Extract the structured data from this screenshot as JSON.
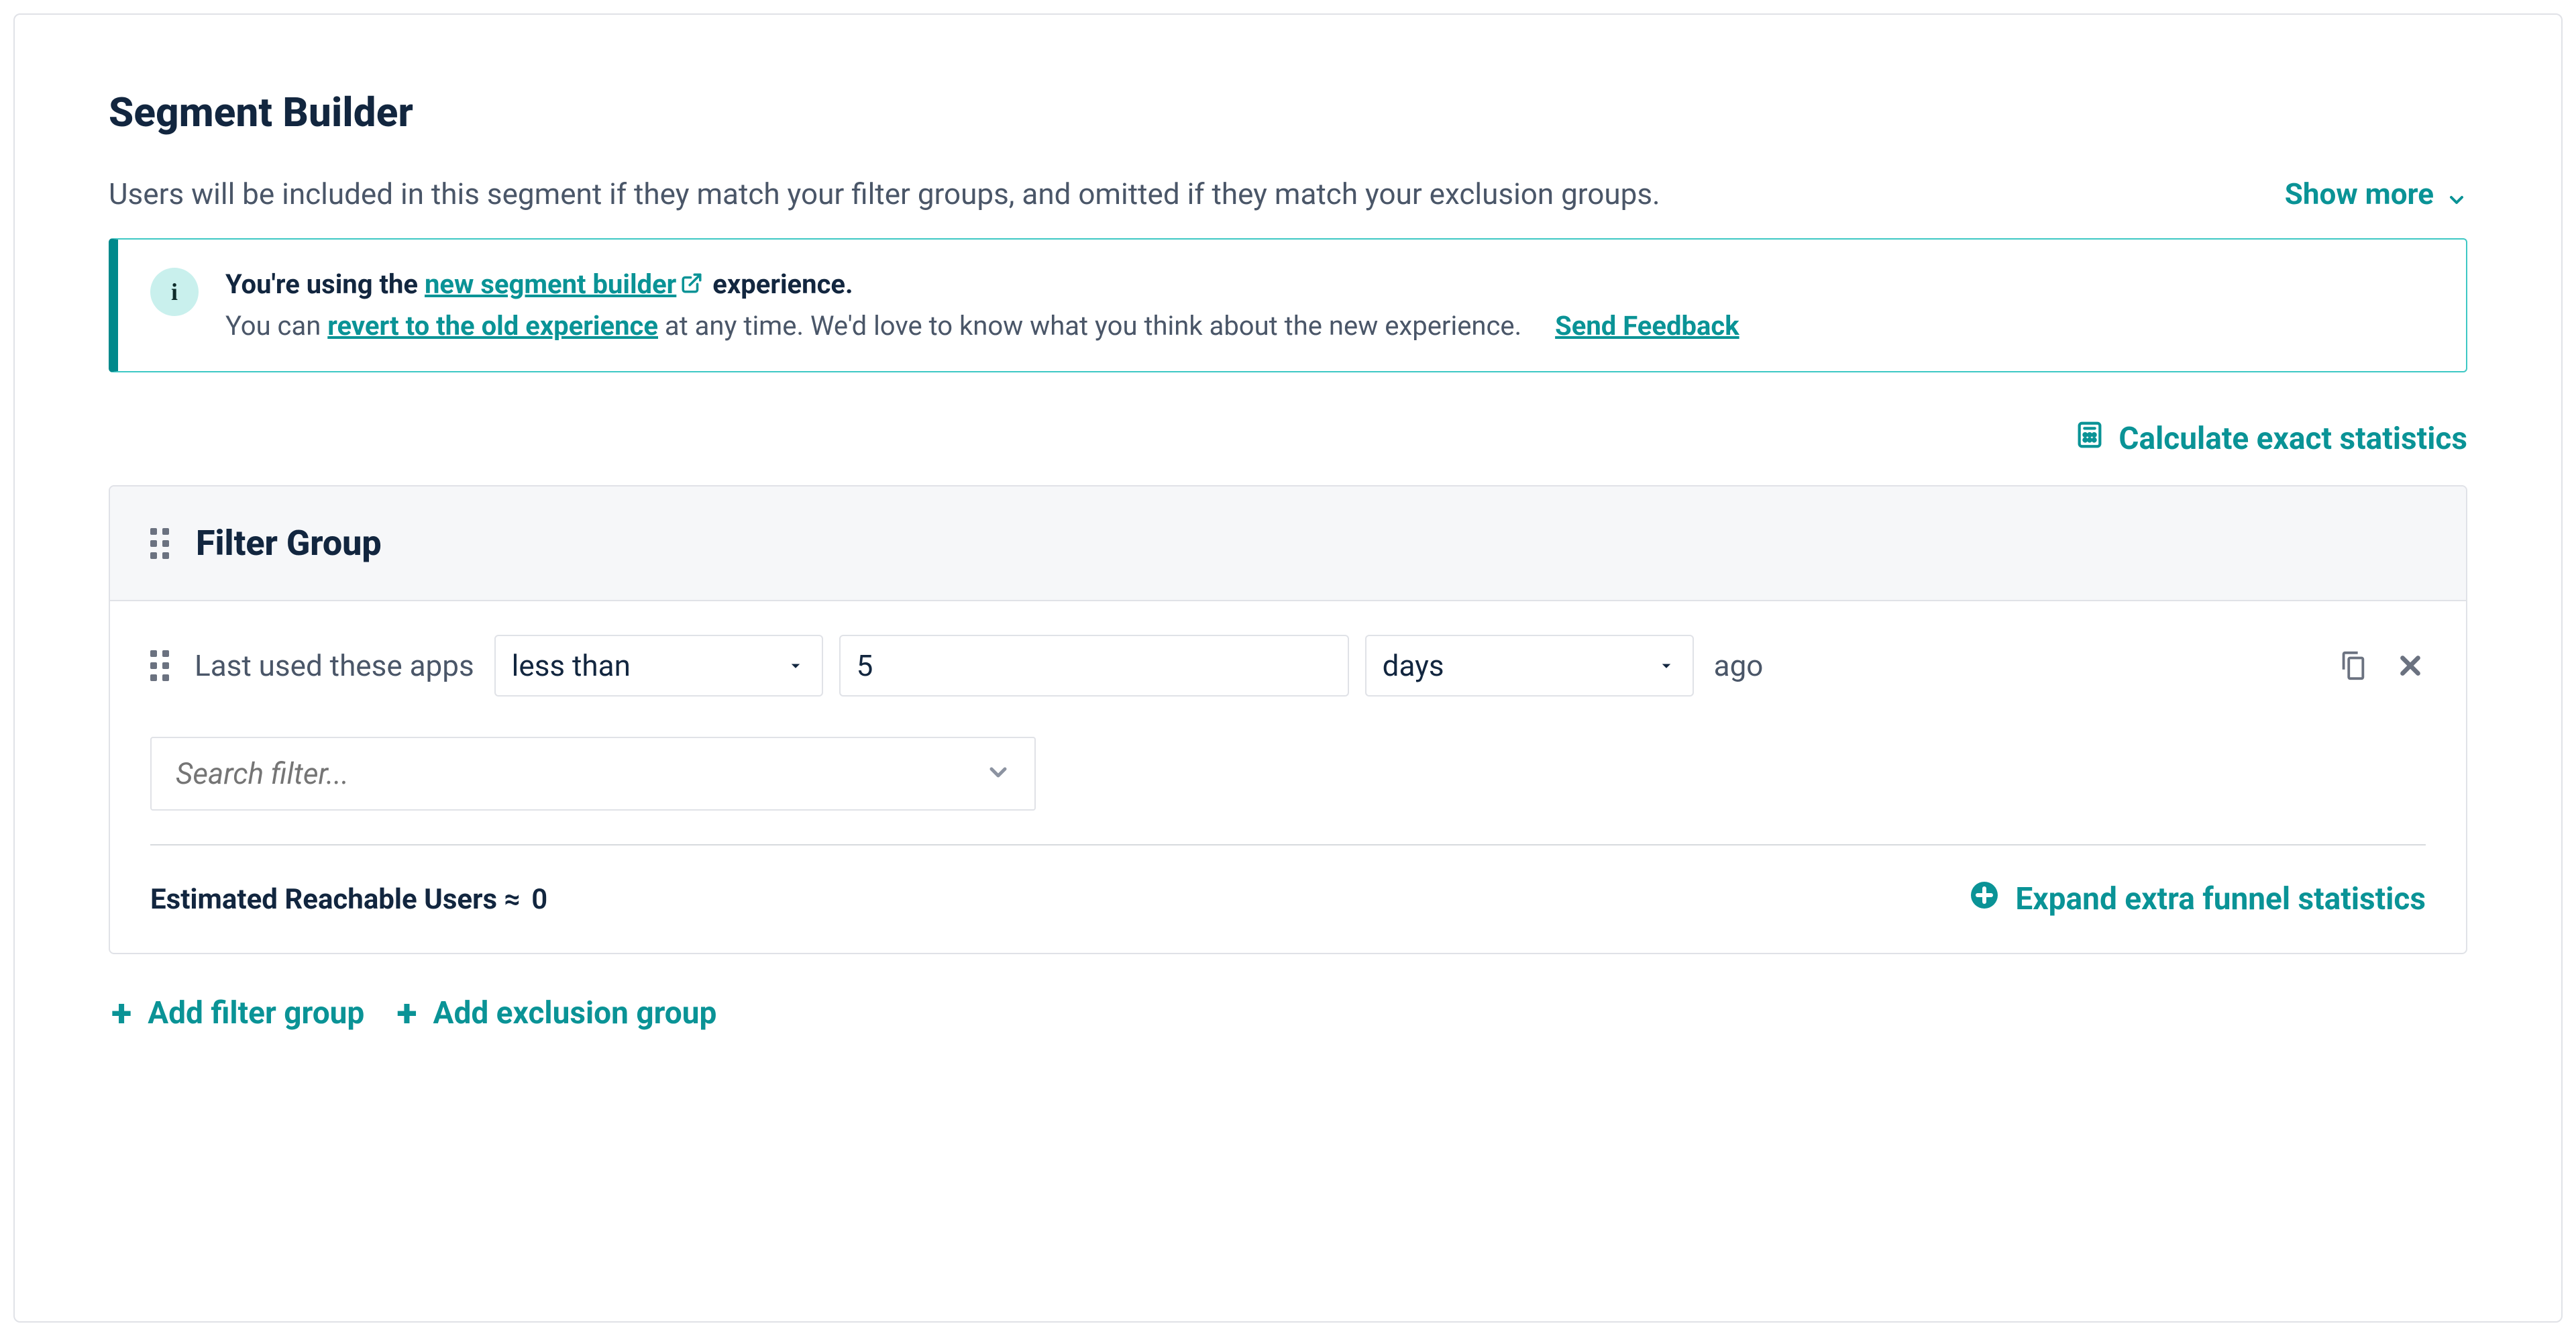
{
  "header": {
    "title": "Segment Builder",
    "intro": "Users will be included in this segment if they match your filter groups, and omitted if they match your exclusion groups.",
    "show_more_label": "Show more"
  },
  "banner": {
    "line1_prefix": "You're using the ",
    "line1_link": "new segment builder",
    "line1_suffix": " experience.",
    "line2_prefix": "You can ",
    "line2_link": "revert to the old experience",
    "line2_suffix": " at any time. We'd love to know what you think about the new experience.",
    "feedback_label": "Send Feedback"
  },
  "stats": {
    "calculate_label": "Calculate exact statistics"
  },
  "filter_group": {
    "title": "Filter Group",
    "row": {
      "label": "Last used these apps",
      "operator": "less than",
      "value": "5",
      "unit": "days",
      "suffix": "ago"
    },
    "search_placeholder": "Search filter...",
    "reach_label": "Estimated Reachable Users ≈",
    "reach_value": "0",
    "expand_label": "Expand extra funnel statistics"
  },
  "actions": {
    "add_filter_group": "Add filter group",
    "add_exclusion_group": "Add exclusion group"
  }
}
